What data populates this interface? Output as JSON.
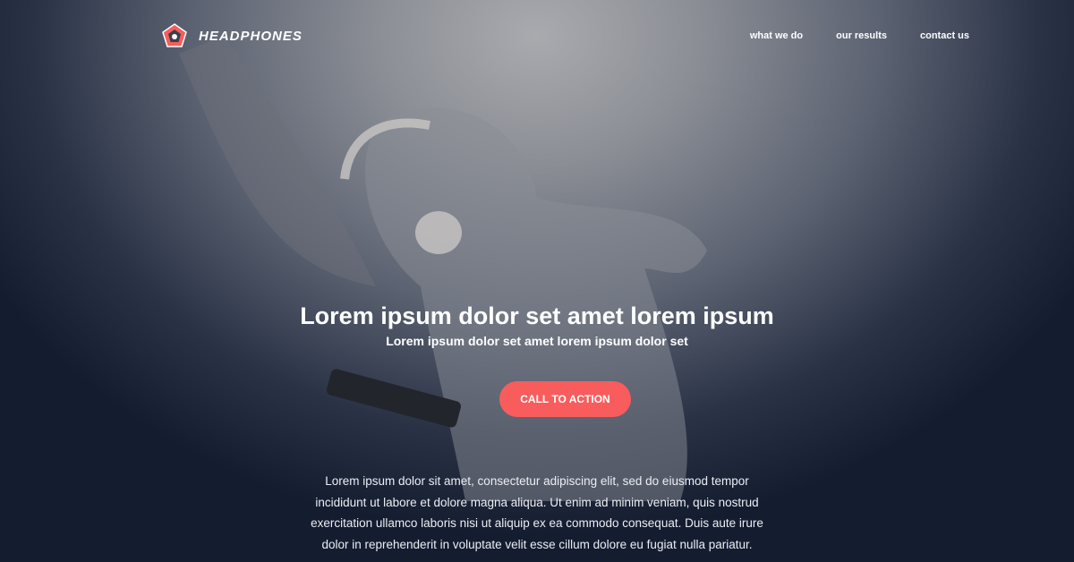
{
  "brand": {
    "name": "HEADPHONES",
    "accent": "#f95c5c"
  },
  "nav": {
    "items": [
      "what we do",
      "our results",
      "contact us"
    ]
  },
  "hero": {
    "title": "Lorem ipsum dolor set amet lorem ipsum",
    "subtitle": "Lorem ipsum dolor set amet lorem ipsum dolor set",
    "cta_label": "CALL TO ACTION",
    "body": "Lorem ipsum dolor sit amet, consectetur adipiscing elit, sed do eiusmod tempor incididunt ut labore et dolore magna aliqua. Ut enim ad minim veniam, quis nostrud exercitation ullamco laboris nisi ut aliquip ex ea commodo consequat. Duis aute irure dolor in reprehenderit in voluptate velit esse cillum dolore eu fugiat nulla pariatur."
  }
}
